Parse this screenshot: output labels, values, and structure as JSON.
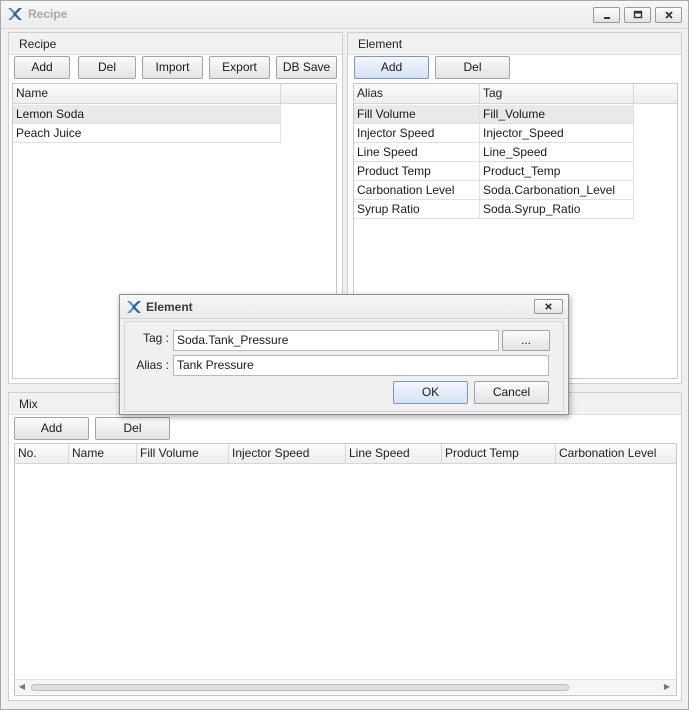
{
  "window": {
    "title": "Recipe"
  },
  "recipe": {
    "header": "Recipe",
    "buttons": {
      "add": "Add",
      "del": "Del",
      "import": "Import",
      "export": "Export",
      "db_save": "DB Save"
    },
    "columns": [
      "Name"
    ],
    "rows": [
      "Lemon Soda",
      "Peach Juice"
    ]
  },
  "element": {
    "header": "Element",
    "buttons": {
      "add": "Add",
      "del": "Del"
    },
    "columns": [
      "Alias",
      "Tag"
    ],
    "rows": [
      [
        "Fill Volume",
        "Fill_Volume"
      ],
      [
        "Injector Speed",
        "Injector_Speed"
      ],
      [
        "Line Speed",
        "Line_Speed"
      ],
      [
        "Product Temp",
        "Product_Temp"
      ],
      [
        "Carbonation Level",
        "Soda.Carbonation_Level"
      ],
      [
        "Syrup Ratio",
        "Soda.Syrup_Ratio"
      ]
    ]
  },
  "mix": {
    "header": "Mix",
    "buttons": {
      "add": "Add",
      "del": "Del"
    },
    "columns": [
      "No.",
      "Name",
      "Fill Volume",
      "Injector Speed",
      "Line Speed",
      "Product Temp",
      "Carbonation Level"
    ]
  },
  "dialog": {
    "title": "Element",
    "tag_label": "Tag :",
    "tag_value": "Soda.Tank_Pressure",
    "browse_label": "...",
    "alias_label": "Alias :",
    "alias_value": "Tank Pressure",
    "ok_label": "OK",
    "cancel_label": "Cancel"
  },
  "colors": {
    "accent": "#7a96c6",
    "selected_row": "#e9e9e9",
    "title_disabled": "#a8a8a8"
  }
}
